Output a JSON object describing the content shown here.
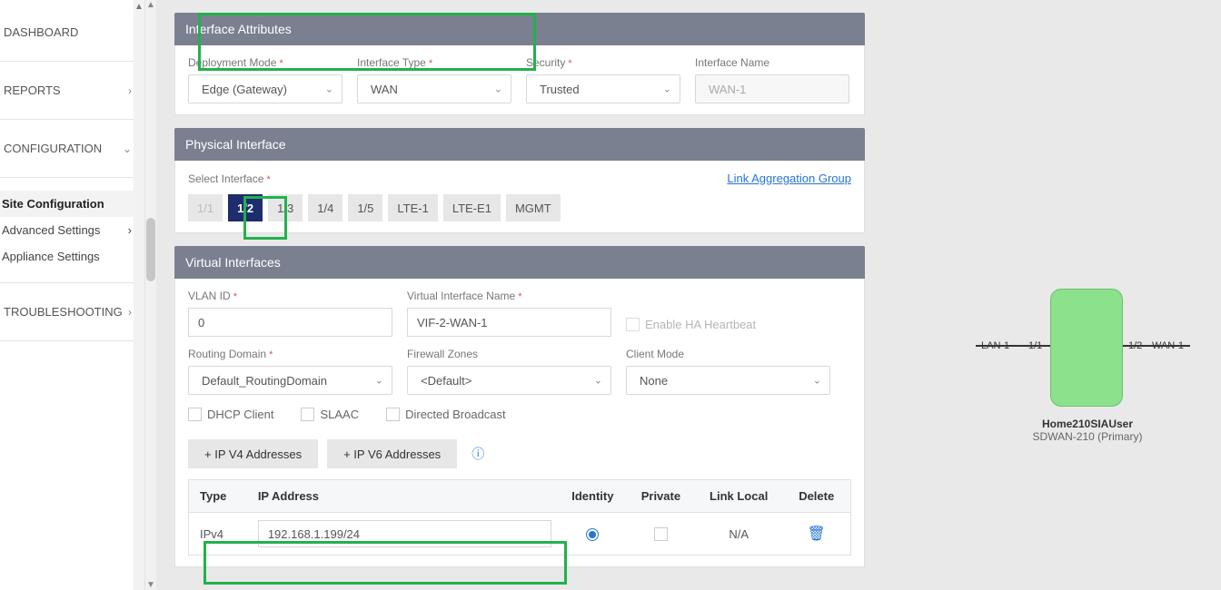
{
  "sidebar": {
    "items": [
      {
        "label": "DASHBOARD",
        "chev": ""
      },
      {
        "label": "REPORTS",
        "chev": "›"
      },
      {
        "label": "CONFIGURATION",
        "chev": "⌄"
      },
      {
        "label": "TROUBLESHOOTING",
        "chev": "›"
      }
    ],
    "sub": [
      {
        "label": "Site Configuration",
        "chev": "",
        "active": true
      },
      {
        "label": "Advanced Settings",
        "chev": "›"
      },
      {
        "label": "Appliance Settings",
        "chev": ""
      }
    ]
  },
  "sections": {
    "attrs": {
      "title": "Interface Attributes",
      "deployment_mode": {
        "label": "Deployment Mode",
        "value": "Edge (Gateway)"
      },
      "interface_type": {
        "label": "Interface Type",
        "value": "WAN"
      },
      "security": {
        "label": "Security",
        "value": "Trusted"
      },
      "interface_name": {
        "label": "Interface Name",
        "value": "WAN-1"
      }
    },
    "phys": {
      "title": "Physical Interface",
      "select_label": "Select Interface",
      "link": "Link Aggregation Group",
      "ports": [
        "1/1",
        "1/2",
        "1/3",
        "1/4",
        "1/5",
        "LTE-1",
        "LTE-E1",
        "MGMT"
      ]
    },
    "virt": {
      "title": "Virtual Interfaces",
      "vlan": {
        "label": "VLAN ID",
        "value": "0"
      },
      "vname": {
        "label": "Virtual Interface Name",
        "value": "VIF-2-WAN-1"
      },
      "enable_ha": "Enable HA Heartbeat",
      "routing": {
        "label": "Routing Domain",
        "value": "Default_RoutingDomain"
      },
      "fwzones": {
        "label": "Firewall Zones",
        "value": "<Default>"
      },
      "clientmode": {
        "label": "Client Mode",
        "value": "None"
      },
      "dhcp": "DHCP Client",
      "slaac": "SLAAC",
      "directed": "Directed Broadcast",
      "ipv4_btn": "+ IP V4 Addresses",
      "ipv6_btn": "+ IP V6 Addresses",
      "table": {
        "headers": {
          "type": "Type",
          "ip": "IP Address",
          "identity": "Identity",
          "private": "Private",
          "linklocal": "Link Local",
          "delete": "Delete"
        },
        "rows": [
          {
            "type": "IPv4",
            "ip": "192.168.1.199/24",
            "identity": true,
            "private": false,
            "linklocal": "N/A"
          }
        ]
      }
    }
  },
  "preview": {
    "device_name": "Home210SIAUser",
    "device_model": "SDWAN-210 (Primary)",
    "lan_label": "LAN-1",
    "p11": "1/1",
    "p12": "1/2",
    "wan_label": "WAN-1"
  }
}
